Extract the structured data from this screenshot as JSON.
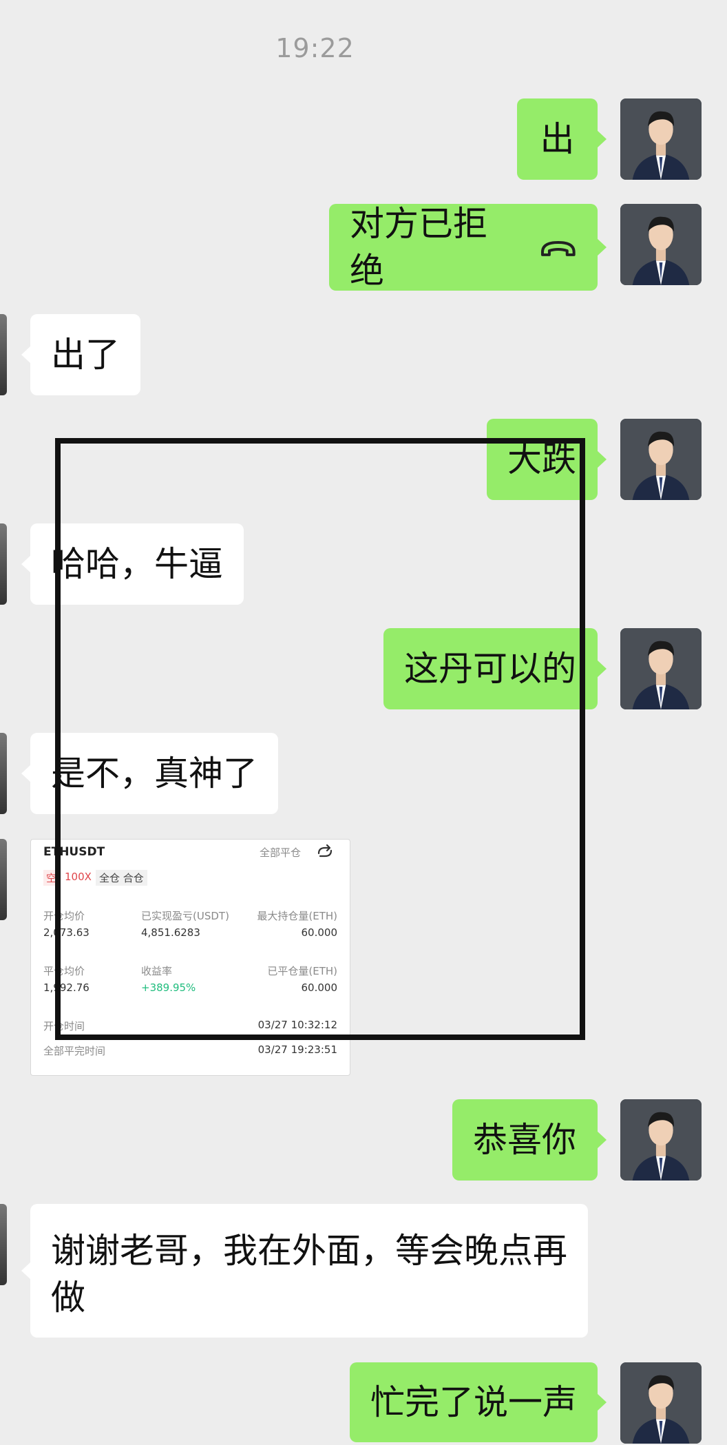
{
  "timestamp": "19:22",
  "messages": [
    {
      "text": "出"
    },
    {
      "text": "对方已拒绝"
    },
    {
      "text": "出了"
    },
    {
      "text": "大跌"
    },
    {
      "text": "哈哈，牛逼"
    },
    {
      "text": "这丹可以的"
    },
    {
      "text": "是不，真神了"
    },
    {
      "text": "恭喜你"
    },
    {
      "text": "谢谢老哥，我在外面，等会晚点再做"
    },
    {
      "text": "忙完了说一声"
    }
  ],
  "trade_card": {
    "symbol": "ETHUSDT",
    "action_label": "全部平仓",
    "share_icon": "share-icon",
    "side": "空",
    "leverage": "100X",
    "margin_mode": "全仓 合仓",
    "open_price_label": "开仓均价",
    "open_price": "2,073.63",
    "realized_pnl_label": "已实现盈亏(USDT)",
    "realized_pnl": "4,851.6283",
    "max_position_label": "最大持仓量(ETH)",
    "max_position": "60.000",
    "close_price_label": "平仓均价",
    "close_price": "1,992.76",
    "return_label": "收益率",
    "return_value": "+389.95%",
    "closed_position_label": "已平仓量(ETH)",
    "closed_position": "60.000",
    "open_time_label": "开仓时间",
    "open_time": "03/27 10:32:12",
    "close_time_label": "全部平完时间",
    "close_time": "03/27 19:23:51"
  },
  "colors": {
    "background": "#ededed",
    "right_bubble": "#95ec69",
    "left_bubble": "#ffffff",
    "profit_green": "#1fbc7d",
    "short_red": "#e0464b"
  },
  "icons": {
    "call_declined": "phone-hangup-icon"
  }
}
